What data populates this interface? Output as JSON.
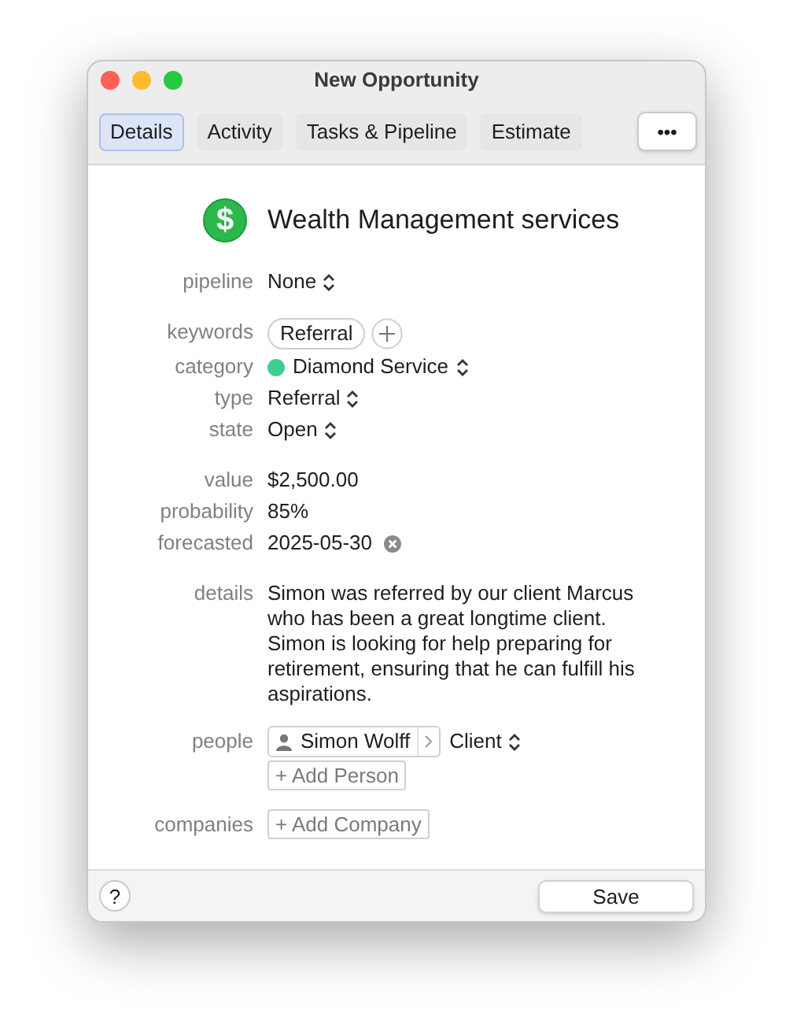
{
  "window": {
    "title": "New Opportunity"
  },
  "tabs": [
    {
      "label": "Details",
      "selected": true
    },
    {
      "label": "Activity",
      "selected": false
    },
    {
      "label": "Tasks & Pipeline",
      "selected": false
    },
    {
      "label": "Estimate",
      "selected": false
    }
  ],
  "more_button": "•••",
  "header": {
    "icon": "$",
    "title": "Wealth Management services"
  },
  "groups": [
    [
      {
        "kind": "popup",
        "label": "pipeline",
        "value": "None"
      }
    ],
    [
      {
        "kind": "tags",
        "label": "keywords",
        "tags": [
          "Referral"
        ]
      },
      {
        "kind": "category",
        "label": "category",
        "value": "Diamond Service",
        "color": "#3ecf8e"
      },
      {
        "kind": "popup",
        "label": "type",
        "value": "Referral"
      },
      {
        "kind": "popup",
        "label": "state",
        "value": "Open"
      }
    ],
    [
      {
        "kind": "text",
        "label": "value",
        "value": "$2,500.00"
      },
      {
        "kind": "text",
        "label": "probability",
        "value": "85%"
      },
      {
        "kind": "date",
        "label": "forecasted",
        "value": "2025-05-30"
      }
    ],
    [
      {
        "kind": "paragraph",
        "label": "details",
        "value": "Simon was referred by our client Marcus who has been a great longtime client. Simon is looking for help preparing for retirement, ensuring that he can fulfill his aspirations."
      }
    ],
    [
      {
        "kind": "people",
        "label": "people",
        "people": [
          {
            "name": "Simon Wolff",
            "role": "Client"
          }
        ],
        "add": "+ Add Person"
      }
    ],
    [
      {
        "kind": "add",
        "label": "companies",
        "add": "+ Add Company"
      }
    ]
  ],
  "footer": {
    "help": "?",
    "save": "Save"
  }
}
